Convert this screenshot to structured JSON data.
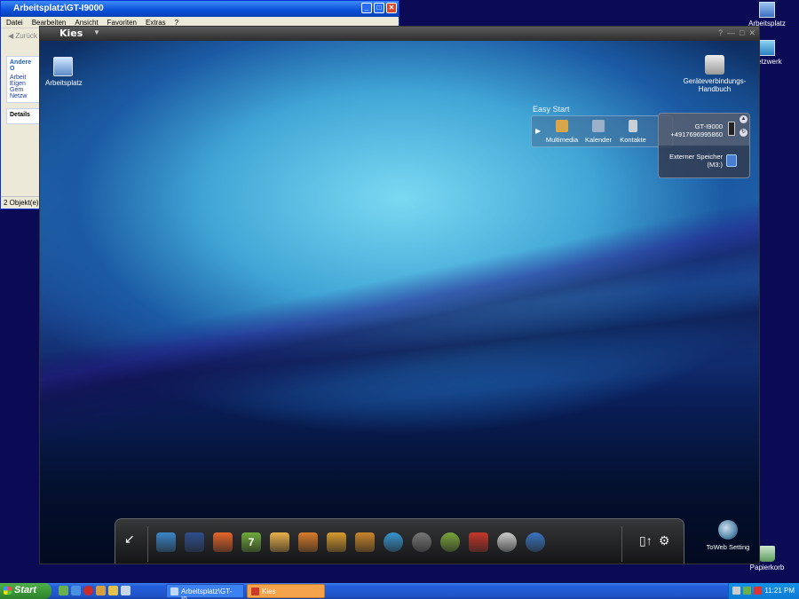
{
  "desktop": {
    "icons": [
      {
        "label": "Arbeitsplatz"
      },
      {
        "label": "Netzwerk"
      },
      {
        "label": "Papierkorb"
      }
    ]
  },
  "explorer": {
    "title": "Arbeitsplatz\\GT-I9000",
    "menu": [
      "Datei",
      "Bearbeiten",
      "Ansicht",
      "Favoriten",
      "Extras",
      "?"
    ],
    "back_label": "Zurück",
    "panel_heading": "Andere O",
    "panel_items": [
      "Arbeit",
      "Eigen",
      "Gem",
      "Netzw"
    ],
    "details_heading": "Details",
    "status": "2 Objekt(e)"
  },
  "kies": {
    "app_name": "Kies",
    "title_buttons": {
      "help": "?",
      "min": "—",
      "max": "□",
      "close": "✕"
    },
    "desktop_icon": "Arbeitsplatz",
    "manual_icon": "Geräteverbindungs-Handbuch",
    "easy_start": {
      "label": "Easy Start",
      "items": [
        {
          "label": "Multimedia",
          "color": "#d9a64a"
        },
        {
          "label": "Kalender",
          "color": "#9bb1c9"
        },
        {
          "label": "Kontakte",
          "color": "#c7cfd8"
        }
      ]
    },
    "device": {
      "name": "GT-I9000",
      "number": "+4917696995860",
      "storage_label": "Externer Speicher",
      "storage_drive": "(M3:)"
    },
    "dock": {
      "apps": [
        {
          "name": "apps-icon",
          "color": "#3a86c8"
        },
        {
          "name": "upload-icon",
          "color": "#2e4e8e"
        },
        {
          "name": "phone-icon",
          "color": "#e5652a"
        },
        {
          "name": "calendar-icon",
          "color": "#6faa3a",
          "glyph": "7"
        },
        {
          "name": "message-icon",
          "color": "#e8b04a"
        },
        {
          "name": "memo-icon",
          "color": "#d87b2a"
        },
        {
          "name": "photo-icon",
          "color": "#d59a2e"
        },
        {
          "name": "photo-edit-icon",
          "color": "#c9852b"
        },
        {
          "name": "music-icon",
          "color": "#3796d0"
        },
        {
          "name": "video-icon",
          "color": "#777777"
        },
        {
          "name": "browser-icon",
          "color": "#7aa53c"
        },
        {
          "name": "podcast-icon",
          "color": "#c4372b"
        },
        {
          "name": "disc-icon",
          "color": "#cccccc"
        },
        {
          "name": "web-icon",
          "color": "#3a74c0"
        }
      ],
      "gear_glyph": "⚙",
      "collapse_glyph": "↙"
    },
    "toweb_label": "ToWeb Setting"
  },
  "taskbar": {
    "start_label": "Start",
    "tasks": [
      {
        "label": "Arbeitsplatz\\GT-I9..."
      },
      {
        "label": "Kies"
      }
    ],
    "clock": "11:21 PM"
  }
}
